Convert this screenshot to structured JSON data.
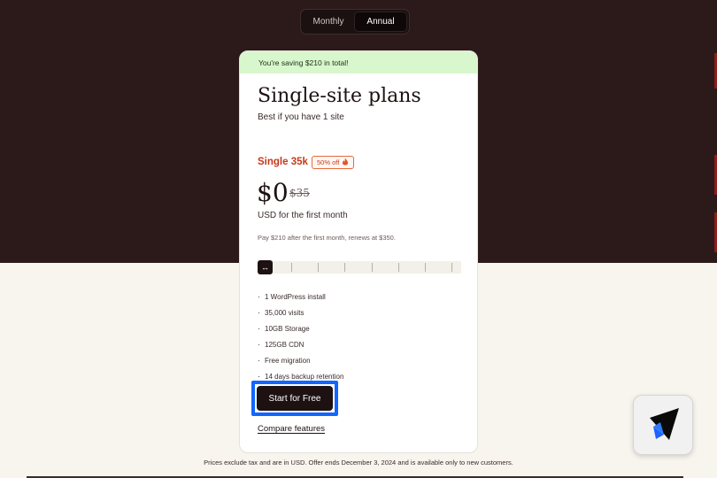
{
  "billing_toggle": {
    "options": [
      "Monthly",
      "Annual"
    ],
    "selected": "Annual"
  },
  "plan_card": {
    "savings_banner": "You're saving $210 in total!",
    "title": "Single-site plans",
    "subtitle": "Best if you have 1 site",
    "tier_name": "Single 35k",
    "discount_badge": "50% off",
    "discount_icon": "flame-icon",
    "price_now": "$0",
    "price_was": "$35",
    "price_note": "USD for the first month",
    "renewal_note": "Pay $210 after the first month, renews at $350.",
    "slider": {
      "position": 0,
      "steps": 8
    },
    "features": [
      "1 WordPress install",
      "35,000 visits",
      "10GB Storage",
      "125GB CDN",
      "Free migration",
      "14 days backup retention"
    ],
    "cta_label": "Start for Free",
    "compare_label": "Compare features"
  },
  "footnote": "Prices exclude tax and are in USD. Offer ends December 3, 2024 and is available only to new customers.",
  "colors": {
    "hero_bg": "#2b1a19",
    "page_bg": "#f8f4ee",
    "accent_red": "#c6391b",
    "savings_green": "#d8f7cd",
    "highlight_blue": "#1266ff"
  }
}
